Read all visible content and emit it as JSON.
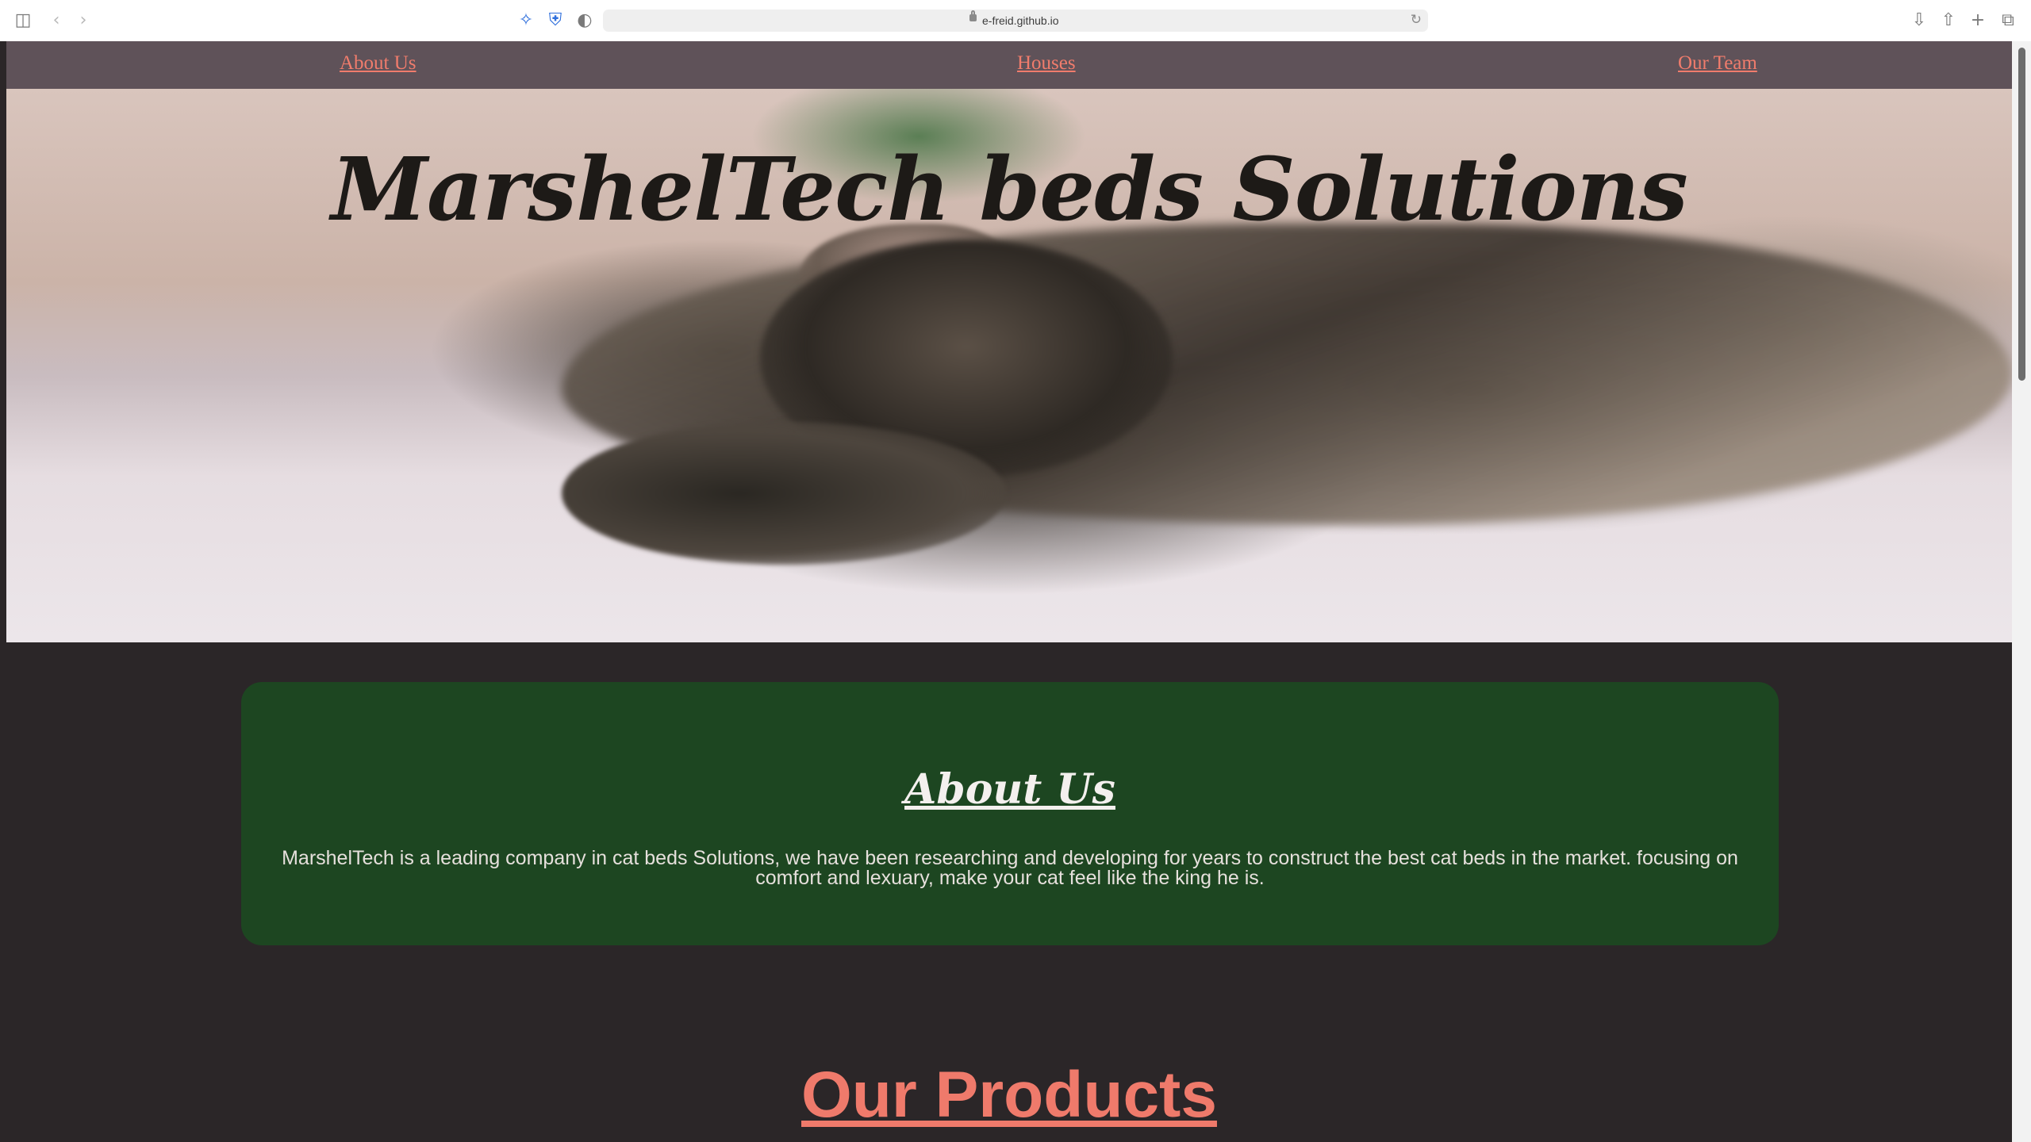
{
  "browser": {
    "url": "e-freid.github.io"
  },
  "nav": {
    "items": [
      {
        "label": "About Us"
      },
      {
        "label": "Houses"
      },
      {
        "label": "Our Team"
      }
    ]
  },
  "hero": {
    "title": "MarshelTech beds Solutions"
  },
  "about": {
    "heading": "About Us",
    "text": "MarshelTech is a leading company in cat beds Solutions, we have been researching and developing for years to construct the best cat beds in the market. focusing on comfort and lexuary, make your cat feel like the king he is."
  },
  "products": {
    "heading": "Our Products"
  },
  "colors": {
    "nav_background": "#5f5259",
    "link": "#f07c6c",
    "page_background": "#2b2628",
    "about_card": "#1d4621"
  }
}
